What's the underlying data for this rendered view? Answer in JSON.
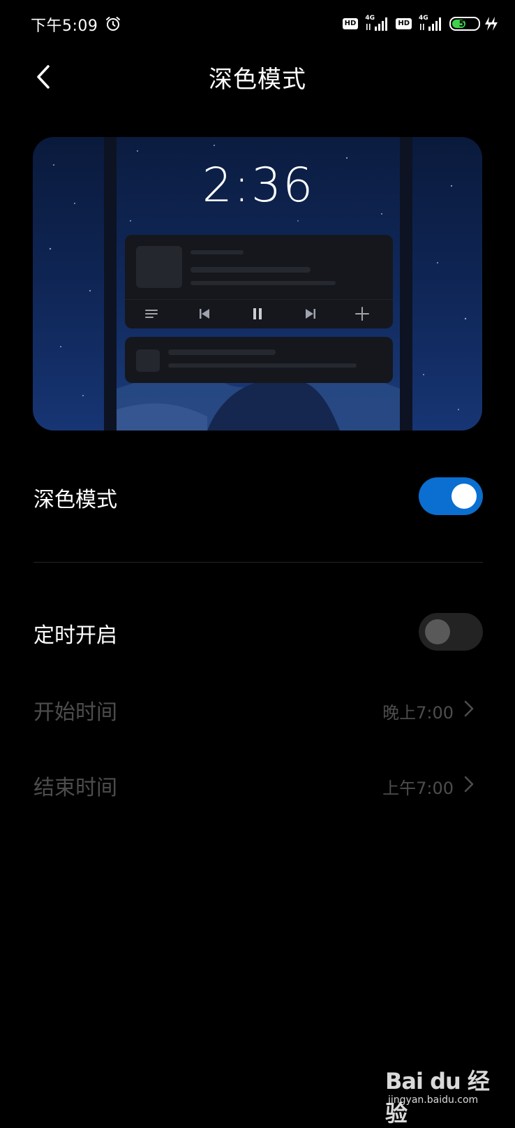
{
  "status_bar": {
    "time": "下午5:09",
    "sim1_hd": "HD",
    "sim1_network": "4G",
    "sim2_hd": "HD",
    "sim2_network": "4G",
    "battery_level": "52",
    "battery_fraction": 0.52,
    "battery_color": "#3fd14a",
    "icons": [
      "alarm-icon",
      "signal-icon",
      "battery-icon",
      "charging-icon"
    ]
  },
  "header": {
    "title": "深色模式",
    "back_icon": "chevron-left-icon"
  },
  "preview": {
    "clock": "2:36",
    "music_controls": [
      "playlist-icon",
      "previous-icon",
      "pause-icon",
      "next-icon",
      "add-icon"
    ]
  },
  "settings": {
    "dark_mode": {
      "label": "深色模式",
      "enabled": true
    },
    "scheduled": {
      "label": "定时开启",
      "enabled": false
    },
    "start_time": {
      "label": "开始时间",
      "value": "晚上7:00"
    },
    "end_time": {
      "label": "结束时间",
      "value": "上午7:00"
    }
  },
  "watermark": {
    "logo": "Bai du 经验",
    "sub": "jingyan.baidu.com"
  },
  "colors": {
    "background": "#000000",
    "accent": "#0a6fd0",
    "disabled_text": "#4d4d4d"
  }
}
